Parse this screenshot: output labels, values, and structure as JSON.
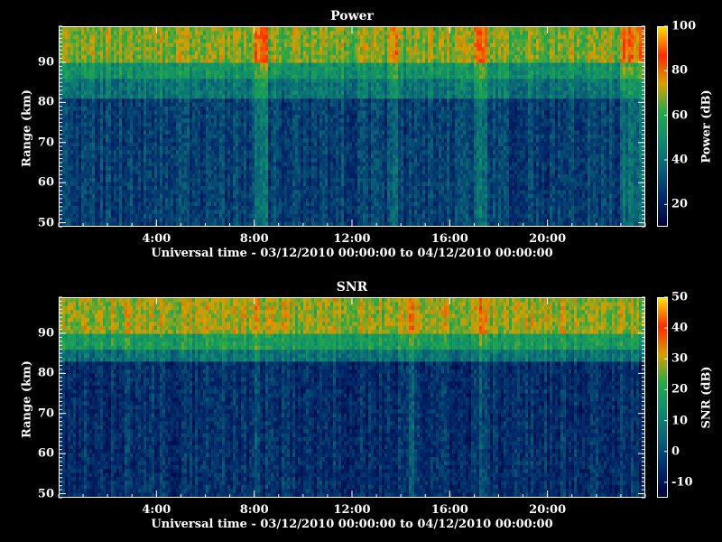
{
  "chart_data": [
    {
      "type": "heatmap",
      "title": "Power",
      "xlabel": "Universal time - 03/12/2010 00:00:00 to 04/12/2010 00:00:00",
      "ylabel": "Range (km)",
      "colorbar_label": "Power (dB)",
      "x_range": [
        0,
        24
      ],
      "x_ticks": [
        "4:00",
        "8:00",
        "12:00",
        "16:00",
        "20:00"
      ],
      "x_tick_values": [
        4,
        8,
        12,
        16,
        20
      ],
      "y_range": [
        49,
        99
      ],
      "y_ticks": [
        50,
        60,
        70,
        80,
        90
      ],
      "colorbar_range": [
        10,
        100
      ],
      "colorbar_ticks": [
        20,
        40,
        60,
        80,
        100
      ],
      "grid": false,
      "layers": [
        {
          "range_km": [
            49,
            81
          ],
          "value": 28
        },
        {
          "range_km": [
            81,
            86
          ],
          "value": 42
        },
        {
          "range_km": [
            86,
            90
          ],
          "value": 52
        },
        {
          "range_km": [
            90,
            99
          ],
          "value": 68
        }
      ],
      "bright_bands_ut_hours": [
        [
          8.0,
          8.6
        ],
        [
          13.5,
          13.9
        ],
        [
          17.0,
          17.6
        ],
        [
          23.0,
          24.0
        ]
      ],
      "colormap": [
        "#000040",
        "#002a6a",
        "#0a5e78",
        "#0f8a6e",
        "#23a84a",
        "#d8a000",
        "#ff2a00",
        "#ffe000"
      ]
    },
    {
      "type": "heatmap",
      "title": "SNR",
      "xlabel": "Universal time - 03/12/2010 00:00:00 to 04/12/2010 00:00:00",
      "ylabel": "Range (km)",
      "colorbar_label": "SNR (dB)",
      "x_range": [
        0,
        24
      ],
      "x_ticks": [
        "4:00",
        "8:00",
        "12:00",
        "16:00",
        "20:00"
      ],
      "x_tick_values": [
        4,
        8,
        12,
        16,
        20
      ],
      "y_range": [
        49,
        99
      ],
      "y_ticks": [
        50,
        60,
        70,
        80,
        90
      ],
      "colorbar_range": [
        -15,
        50
      ],
      "colorbar_ticks": [
        -10,
        0,
        10,
        20,
        30,
        40,
        50
      ],
      "grid": false,
      "layers": [
        {
          "range_km": [
            49,
            83
          ],
          "value": -5
        },
        {
          "range_km": [
            83,
            86
          ],
          "value": 8
        },
        {
          "range_km": [
            86,
            90
          ],
          "value": 18
        },
        {
          "range_km": [
            90,
            99
          ],
          "value": 28
        }
      ],
      "bright_bands_ut_hours": [
        [
          8.0,
          8.2
        ],
        [
          14.3,
          14.5
        ],
        [
          17.2,
          17.5
        ]
      ],
      "colormap": [
        "#000040",
        "#002a6a",
        "#0a5e78",
        "#0f8a6e",
        "#23a84a",
        "#d8a000",
        "#ff2a00",
        "#ffe000"
      ]
    }
  ]
}
